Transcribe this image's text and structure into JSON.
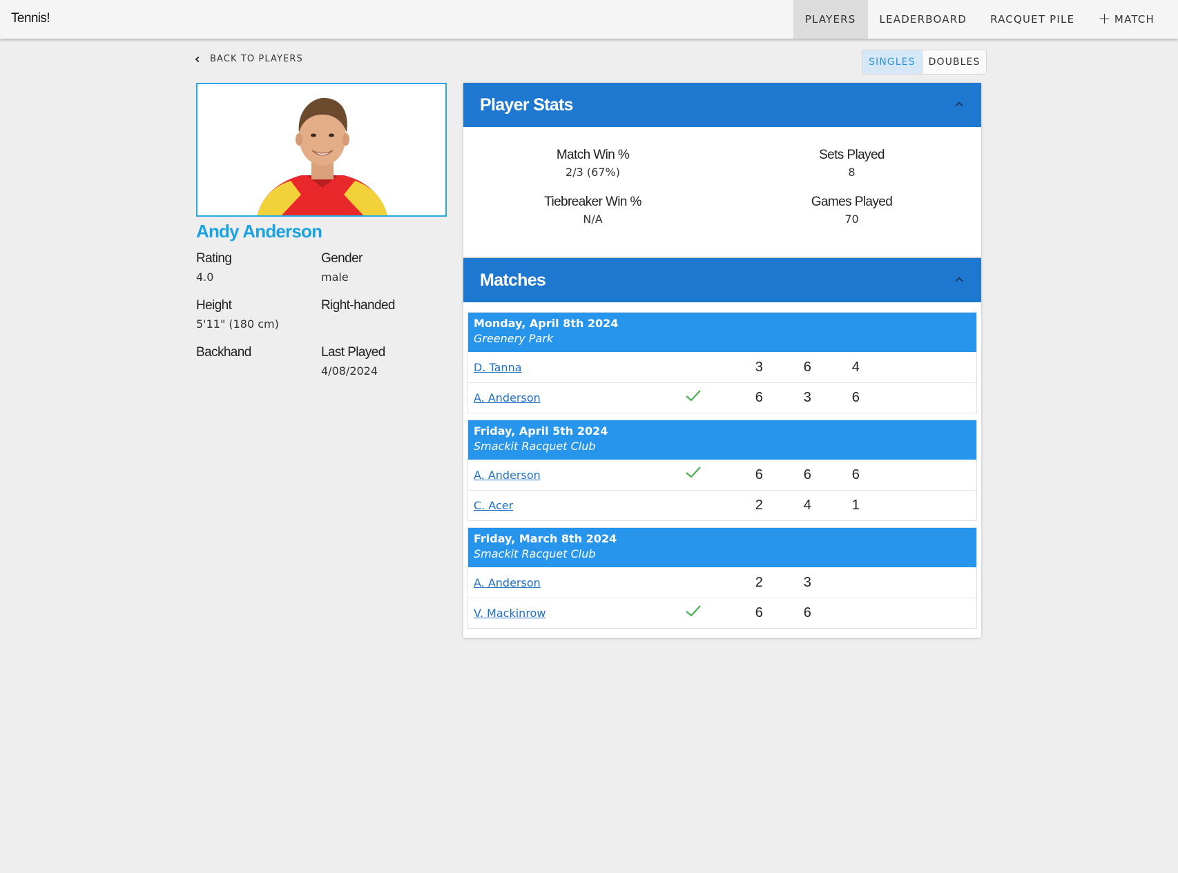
{
  "app": {
    "title": "Tennis!"
  },
  "nav": {
    "players": "PLAYERS",
    "leaderboard": "LEADERBOARD",
    "racquet_pile": "RACQUET PILE",
    "match_plus": "+",
    "match": "MATCH"
  },
  "back_link": "BACK TO PLAYERS",
  "mode_toggle": {
    "singles": "SINGLES",
    "doubles": "DOUBLES",
    "selected": "SINGLES"
  },
  "player": {
    "name": "Andy Anderson",
    "rating_label": "Rating",
    "rating": "4.0",
    "gender_label": "Gender",
    "gender": "male",
    "height_label": "Height",
    "height": "5'11\" (180 cm)",
    "hand_label": "Right-handed",
    "backhand_label": "Backhand",
    "last_played_label": "Last Played",
    "last_played": "4/08/2024"
  },
  "stats_panel": {
    "title": "Player Stats",
    "match_win_label": "Match Win %",
    "match_win": "2/3 (67%)",
    "sets_played_label": "Sets Played",
    "sets_played": "8",
    "tiebreaker_label": "Tiebreaker Win %",
    "tiebreaker": "N/A",
    "games_played_label": "Games Played",
    "games_played": "70"
  },
  "matches_panel": {
    "title": "Matches",
    "matches": [
      {
        "date": "Monday, April 8th 2024",
        "venue": "Greenery Park",
        "rows": [
          {
            "name": "D. Tanna",
            "winner": false,
            "scores": [
              "3",
              "6",
              "4"
            ]
          },
          {
            "name": "A. Anderson",
            "winner": true,
            "scores": [
              "6",
              "3",
              "6"
            ]
          }
        ]
      },
      {
        "date": "Friday, April 5th 2024",
        "venue": "Smackit Racquet Club",
        "rows": [
          {
            "name": "A. Anderson",
            "winner": true,
            "scores": [
              "6",
              "6",
              "6"
            ]
          },
          {
            "name": "C. Acer",
            "winner": false,
            "scores": [
              "2",
              "4",
              "1"
            ]
          }
        ]
      },
      {
        "date": "Friday, March 8th 2024",
        "venue": "Smackit Racquet Club",
        "rows": [
          {
            "name": "A. Anderson",
            "winner": false,
            "scores": [
              "2",
              "3"
            ]
          },
          {
            "name": "V. Mackinrow",
            "winner": true,
            "scores": [
              "6",
              "6"
            ]
          }
        ]
      }
    ]
  },
  "colors": {
    "panel_header": "#1e78cf",
    "match_header": "#2895ec",
    "player_name": "#1aa3e0",
    "winner_check": "#4caf50"
  }
}
